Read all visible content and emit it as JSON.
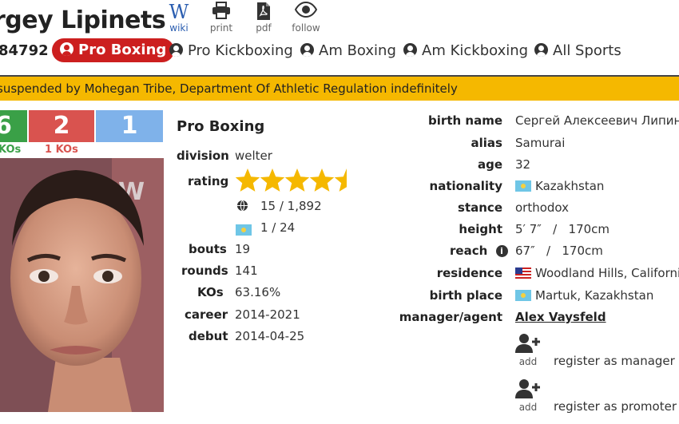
{
  "header": {
    "name": "rgey Lipinets",
    "boxer_id": "84792",
    "tools": [
      {
        "label": "wiki",
        "icon": "wikipedia-icon"
      },
      {
        "label": "print",
        "icon": "printer-icon"
      },
      {
        "label": "pdf",
        "icon": "pdf-icon"
      },
      {
        "label": "follow",
        "icon": "eye-icon"
      }
    ],
    "sports": [
      {
        "label": "Pro Boxing",
        "active": true
      },
      {
        "label": "Pro Kickboxing",
        "active": false
      },
      {
        "label": "Am Boxing",
        "active": false
      },
      {
        "label": "Am Kickboxing",
        "active": false
      },
      {
        "label": "All Sports",
        "active": false
      }
    ]
  },
  "banner": {
    "text": "suspended by Mohegan Tribe, Department Of Athletic Regulation indefinitely",
    "color": "#f5b800"
  },
  "record": {
    "wins": "6",
    "losses": "2",
    "draws": "1",
    "wins_kos": "KOs",
    "losses_kos": "1 KOs",
    "colors": {
      "wins": "#3aa047",
      "losses": "#d9534f",
      "draws": "#7fb2ea"
    }
  },
  "pro_boxing": {
    "title": "Pro Boxing",
    "fields": {
      "division_label": "division",
      "division": "welter",
      "rating_label": "rating",
      "stars": 4.5,
      "world_rank": "15 / 1,892",
      "country_rank": "1 / 24",
      "bouts_label": "bouts",
      "bouts": "19",
      "rounds_label": "rounds",
      "rounds": "141",
      "kos_label": "KOs",
      "kos": "63.16%",
      "career_label": "career",
      "career": "2014-2021",
      "debut_label": "debut",
      "debut": "2014-04-25"
    }
  },
  "bio": {
    "birth_name_label": "birth name",
    "birth_name": "Сергей Алексеевич Липинец",
    "alias_label": "alias",
    "alias": "Samurai",
    "age_label": "age",
    "age": "32",
    "nationality_label": "nationality",
    "nationality": "Kazakhstan",
    "stance_label": "stance",
    "stance": "orthodox",
    "height_label": "height",
    "height": "5′ 7″   /   170cm",
    "reach_label": "reach",
    "reach": "67″   /   170cm",
    "residence_label": "residence",
    "residence": "Woodland Hills, California",
    "birth_place_label": "birth place",
    "birth_place": "Martuk, Kazakhstan",
    "manager_label": "manager/agent",
    "manager": "Alex Vaysfeld",
    "add_label": "add",
    "register_manager": "register as manager",
    "register_promoter": "register as promoter"
  }
}
